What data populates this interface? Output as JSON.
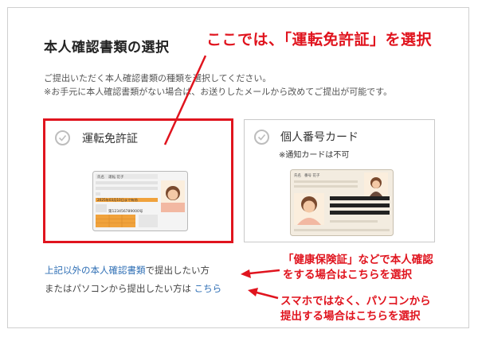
{
  "page": {
    "title": "本人確認書類の選択",
    "instruction_line1": "ご提出いただく本人確認書類の種類を選択してください。",
    "instruction_line2": "※お手元に本人確認書類がない場合は、お送りしたメールから改めてご提出が可能です。"
  },
  "options": [
    {
      "label": "運転免許証",
      "note": "",
      "selected": true
    },
    {
      "label": "個人番号カード",
      "note": "※通知カードは不可",
      "selected": false
    }
  ],
  "license_card": {
    "name_label": "氏名",
    "name_value": "運転 花子",
    "number_text": "第123456789000号",
    "expiry_text": "2025年03月10日まで有効"
  },
  "mynumber_card": {
    "name_label": "氏名",
    "name_value": "番号 花子"
  },
  "links": {
    "other_docs_link": "上記以外の本人確認書類",
    "other_docs_suffix": "で提出したい方",
    "pc_prefix": "またはパソコンから提出したい方は",
    "pc_link": "こちら"
  },
  "annotations": {
    "main": "ここでは、「運転免許証」を選択",
    "health_line1": "「健康保険証」などで本人確認",
    "health_line2": "をする場合はこちらを選択",
    "pc_line1": "スマホではなく、パソコンから",
    "pc_line2": "提出する場合はこちらを選択"
  },
  "colors": {
    "annotation_red": "#e0141e",
    "link_blue": "#2f6fb5",
    "license_orange": "#f0a23c",
    "card_border": "#c9c9c9"
  },
  "icons": [
    "check-circle-icon",
    "arrow-icon"
  ]
}
